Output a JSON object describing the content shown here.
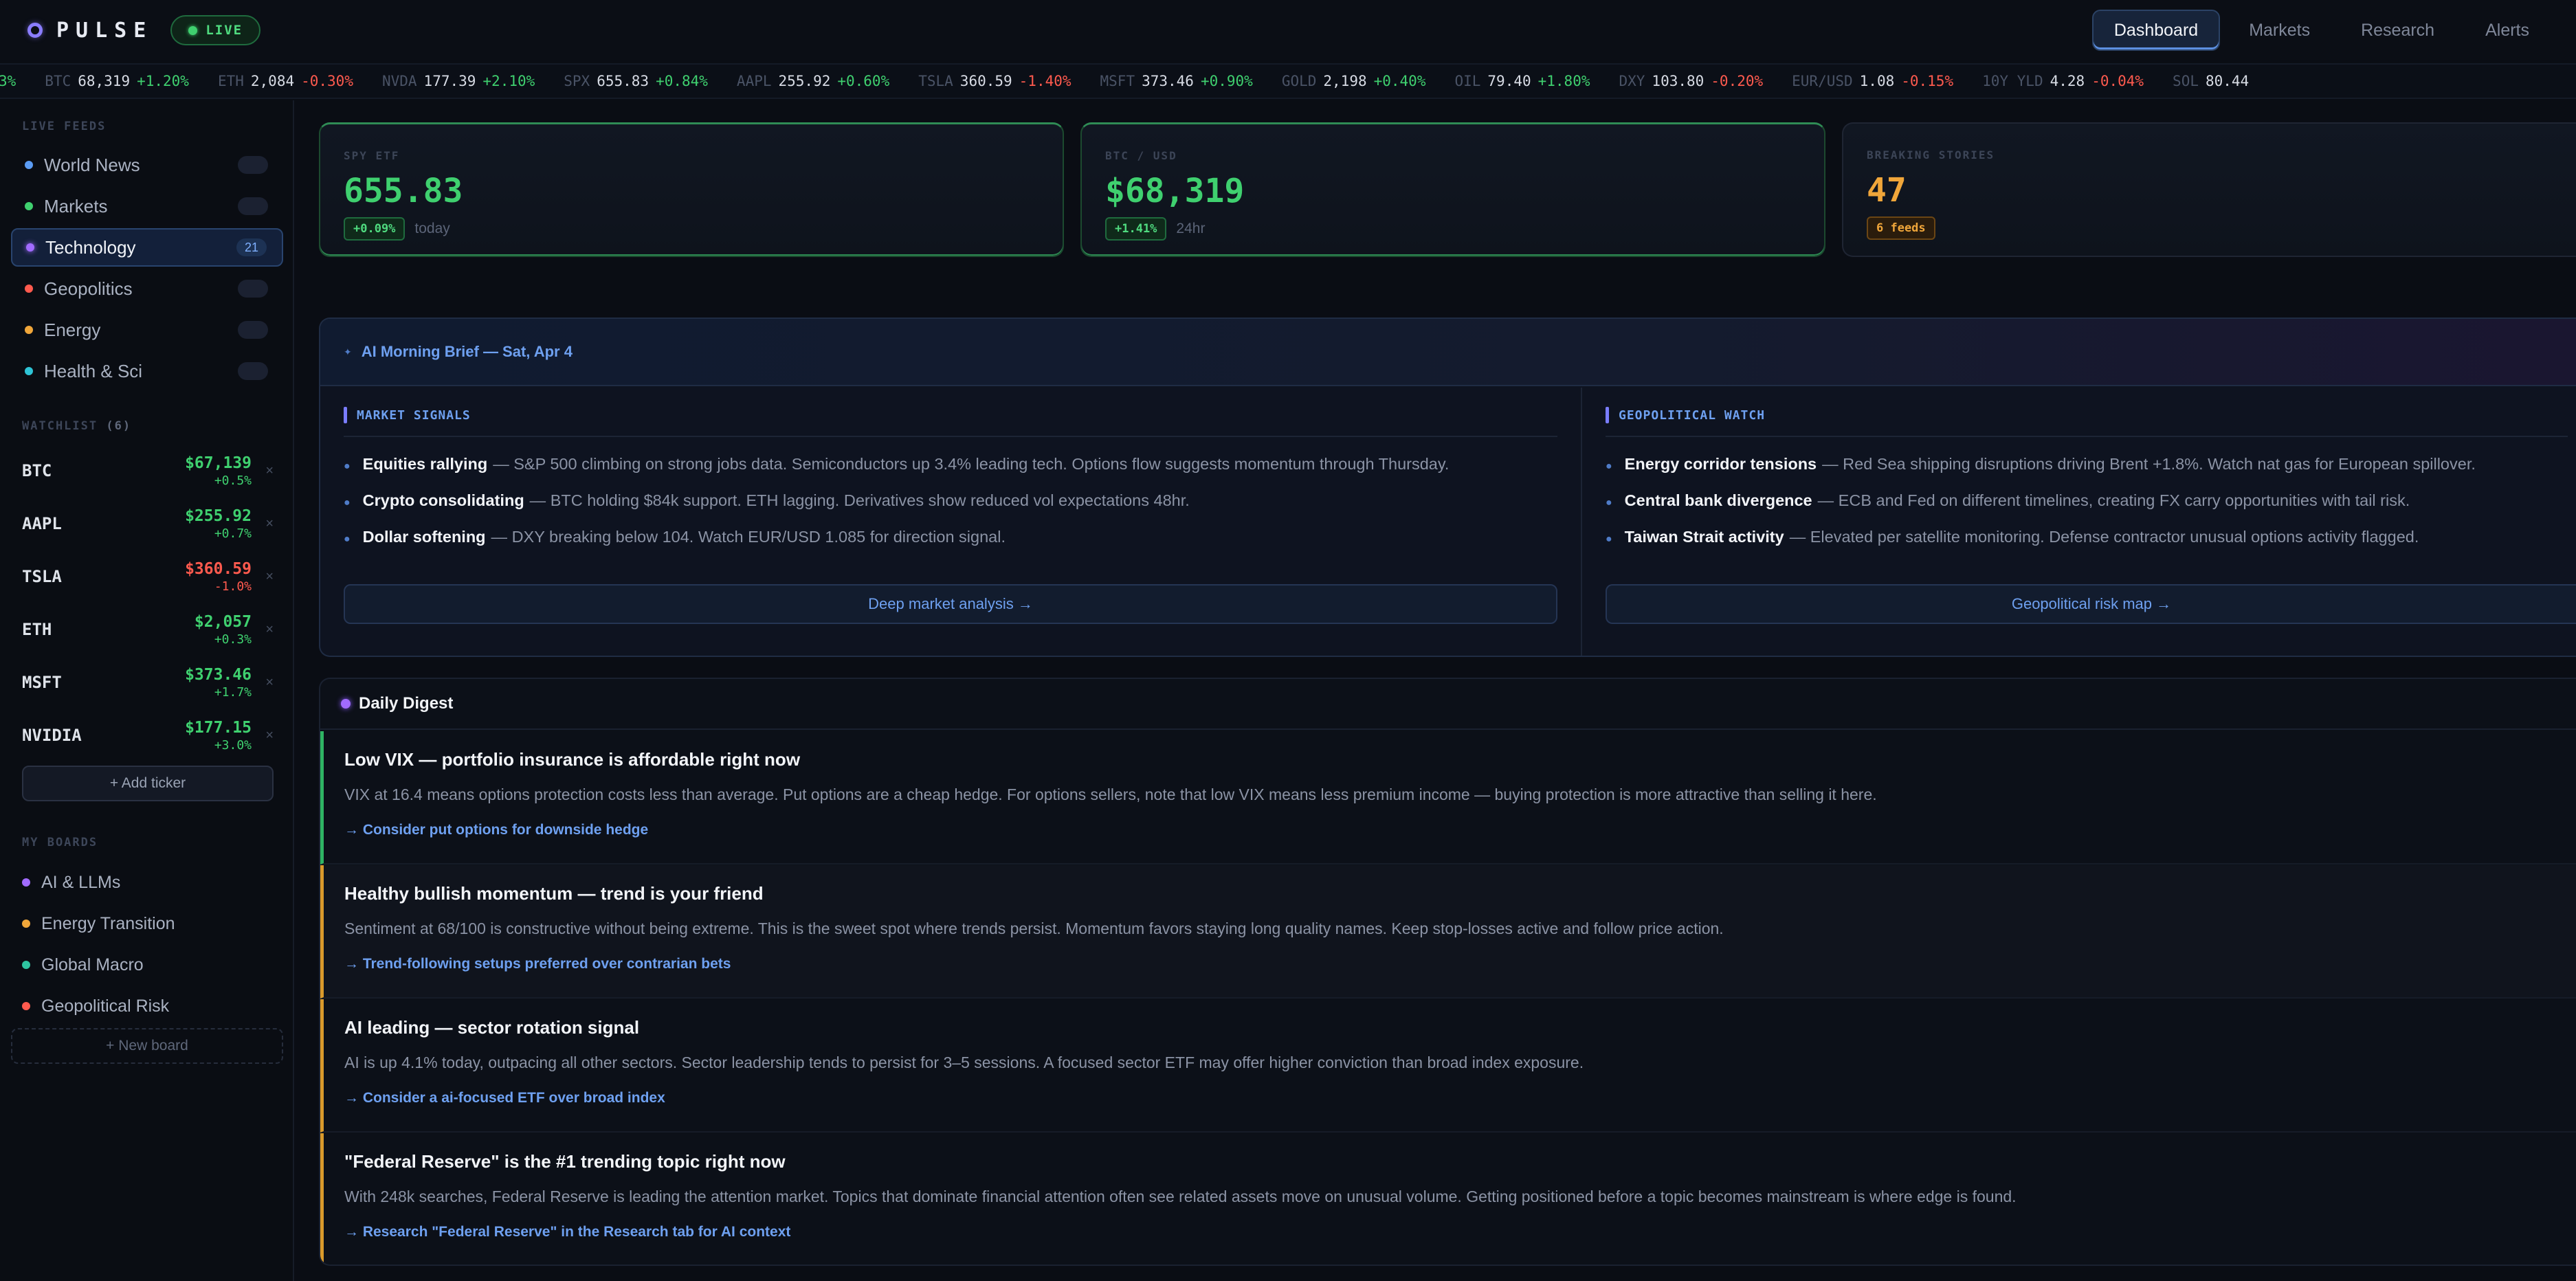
{
  "brand": {
    "name": "PULSE",
    "live_label": "LIVE"
  },
  "nav": {
    "tabs": [
      "Dashboard",
      "Markets",
      "Research",
      "Alerts"
    ]
  },
  "ticker": [
    {
      "sym": "",
      "price": "",
      "change": "3%",
      "dir": "up"
    },
    {
      "sym": "BTC",
      "price": "68,319",
      "change": "+1.20%",
      "dir": "up"
    },
    {
      "sym": "ETH",
      "price": "2,084",
      "change": "-0.30%",
      "dir": "down"
    },
    {
      "sym": "NVDA",
      "price": "177.39",
      "change": "+2.10%",
      "dir": "up"
    },
    {
      "sym": "SPX",
      "price": "655.83",
      "change": "+0.84%",
      "dir": "up"
    },
    {
      "sym": "AAPL",
      "price": "255.92",
      "change": "+0.60%",
      "dir": "up"
    },
    {
      "sym": "TSLA",
      "price": "360.59",
      "change": "-1.40%",
      "dir": "down"
    },
    {
      "sym": "MSFT",
      "price": "373.46",
      "change": "+0.90%",
      "dir": "up"
    },
    {
      "sym": "GOLD",
      "price": "2,198",
      "change": "+0.40%",
      "dir": "up"
    },
    {
      "sym": "OIL",
      "price": "79.40",
      "change": "+1.80%",
      "dir": "up"
    },
    {
      "sym": "DXY",
      "price": "103.80",
      "change": "-0.20%",
      "dir": "down"
    },
    {
      "sym": "EUR/USD",
      "price": "1.08",
      "change": "-0.15%",
      "dir": "down"
    },
    {
      "sym": "10Y YLD",
      "price": "4.28",
      "change": "-0.04%",
      "dir": "down"
    },
    {
      "sym": "SOL",
      "price": "80.44",
      "change": "",
      "dir": "up"
    }
  ],
  "sidebar": {
    "live_feeds_label": "LIVE FEEDS",
    "feeds": [
      {
        "label": "World News",
        "count": "",
        "color": "#5b9cf5"
      },
      {
        "label": "Markets",
        "count": "",
        "color": "#3fd06f"
      },
      {
        "label": "Technology",
        "count": "21",
        "color": "#a16bff"
      },
      {
        "label": "Geopolitics",
        "count": "",
        "color": "#ff5a4e"
      },
      {
        "label": "Energy",
        "count": "",
        "color": "#f0a63a"
      },
      {
        "label": "Health & Sci",
        "count": "",
        "color": "#2ec4d6"
      }
    ],
    "watchlist_label": "WATCHLIST",
    "watchlist_count": "(6)",
    "watchlist": [
      {
        "sym": "BTC",
        "price": "$67,139",
        "change": "+0.5%",
        "dir": "up"
      },
      {
        "sym": "AAPL",
        "price": "$255.92",
        "change": "+0.7%",
        "dir": "up"
      },
      {
        "sym": "TSLA",
        "price": "$360.59",
        "change": "-1.0%",
        "dir": "down"
      },
      {
        "sym": "ETH",
        "price": "$2,057",
        "change": "+0.3%",
        "dir": "up"
      },
      {
        "sym": "MSFT",
        "price": "$373.46",
        "change": "+1.7%",
        "dir": "up"
      },
      {
        "sym": "NVIDIA",
        "price": "$177.15",
        "change": "+3.0%",
        "dir": "up"
      }
    ],
    "add_ticker": "+ Add ticker",
    "boards_label": "MY BOARDS",
    "boards": [
      {
        "label": "AI & LLMs",
        "color": "#a16bff"
      },
      {
        "label": "Energy Transition",
        "color": "#f0a63a"
      },
      {
        "label": "Global Macro",
        "color": "#2ec4a0"
      },
      {
        "label": "Geopolitical Risk",
        "color": "#ff5a4e"
      }
    ],
    "new_board": "+ New board"
  },
  "stats": [
    {
      "label": "SPY ETF",
      "value": "655.83",
      "badge": "+0.09%",
      "period": "today"
    },
    {
      "label": "BTC / USD",
      "value": "$68,319",
      "badge": "+1.41%",
      "period": "24hr"
    },
    {
      "label": "BREAKING STORIES",
      "value": "47",
      "badge": "6 feeds",
      "period": ""
    }
  ],
  "brief": {
    "title": "AI Morning Brief —  Sat, Apr 4",
    "market_title": "MARKET SIGNALS",
    "market_items": [
      {
        "lead": "Equities rallying",
        "text": "— S&P 500 climbing on strong jobs data. Semiconductors up 3.4% leading tech. Options flow suggests momentum through Thursday."
      },
      {
        "lead": "Crypto consolidating",
        "text": "— BTC holding $84k support. ETH lagging. Derivatives show reduced vol expectations 48hr."
      },
      {
        "lead": "Dollar softening",
        "text": "— DXY breaking below 104. Watch EUR/USD 1.085 for direction signal."
      }
    ],
    "market_button": "Deep market analysis →",
    "geo_title": "GEOPOLITICAL WATCH",
    "geo_items": [
      {
        "lead": "Energy corridor tensions",
        "text": "— Red Sea shipping disruptions driving Brent +1.8%. Watch nat gas for European spillover."
      },
      {
        "lead": "Central bank divergence",
        "text": "— ECB and Fed on different timelines, creating FX carry opportunities with tail risk."
      },
      {
        "lead": "Taiwan Strait activity",
        "text": "— Elevated per satellite monitoring. Defense contractor unusual options activity flagged."
      }
    ],
    "geo_button": "Geopolitical risk map →"
  },
  "digest": {
    "title": "Daily Digest",
    "items": [
      {
        "title": "Low VIX — portfolio insurance is affordable right now",
        "body": "VIX at 16.4 means options protection costs less than average. Put options are a cheap hedge. For options sellers, note that low VIX means less premium income — buying protection is more attractive than selling it here.",
        "link": "→ Consider put options for downside hedge"
      },
      {
        "title": "Healthy bullish momentum — trend is your friend",
        "body": "Sentiment at 68/100 is constructive without being extreme. This is the sweet spot where trends persist. Momentum favors staying long quality names. Keep stop-losses active and follow price action.",
        "link": "→ Trend-following setups preferred over contrarian bets"
      },
      {
        "title": "AI leading — sector rotation signal",
        "body": "AI is up 4.1% today, outpacing all other sectors. Sector leadership tends to persist for 3–5 sessions. A focused sector ETF may offer higher conviction than broad index exposure.",
        "link": "→ Consider a ai-focused ETF over broad index"
      },
      {
        "title": "\"Federal Reserve\" is the #1 trending topic right now",
        "body": "With 248k searches, Federal Reserve is leading the attention market. Topics that dominate financial attention often see related assets move on unusual volume. Getting positioned before a topic becomes mainstream is where edge is found.",
        "link": "→ Research \"Federal Reserve\" in the Research tab for AI context"
      }
    ]
  },
  "colors": {
    "up": "#3fd06f",
    "down": "#ff5a4e",
    "accent": "#6ea0f0",
    "breaking": "#f0a63a"
  }
}
